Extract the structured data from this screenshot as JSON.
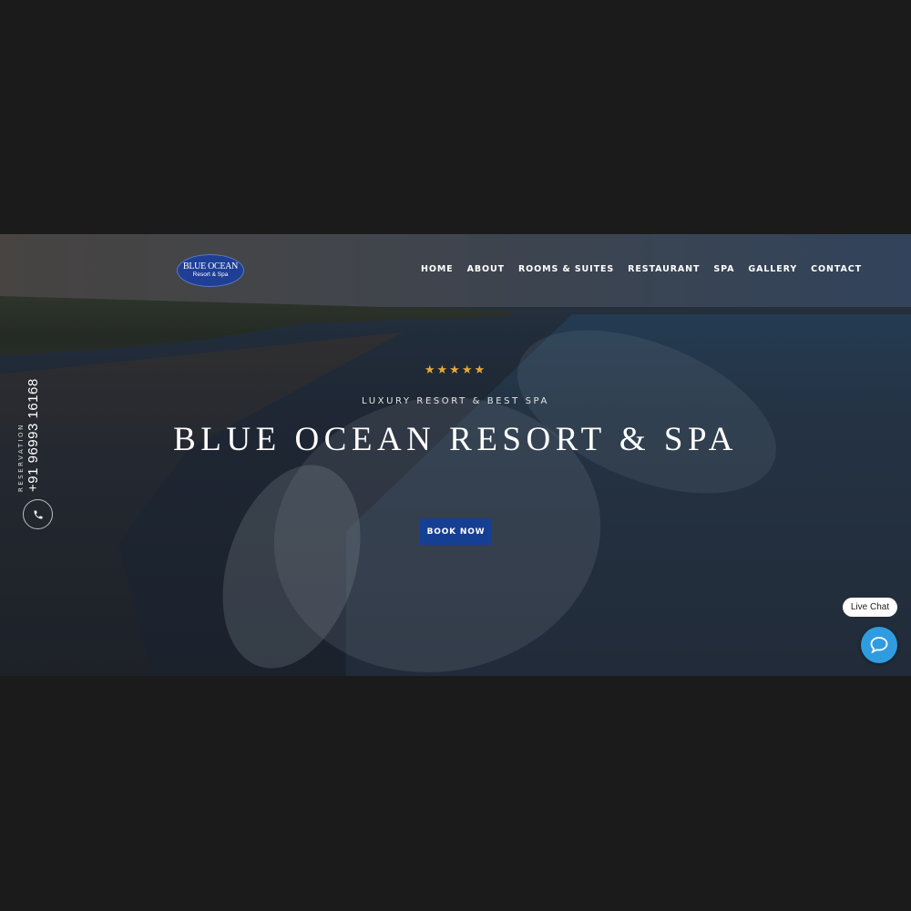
{
  "brand": {
    "logo_main": "BLUE OCEAN",
    "logo_sub": "Resort & Spa"
  },
  "nav": {
    "items": [
      {
        "label": "HOME"
      },
      {
        "label": "ABOUT"
      },
      {
        "label": "ROOMS & SUITES"
      },
      {
        "label": "RESTAURANT"
      },
      {
        "label": "SPA"
      },
      {
        "label": "GALLERY"
      },
      {
        "label": "CONTACT"
      }
    ]
  },
  "hero": {
    "stars": "★★★★★",
    "rating": 5,
    "tagline": "LUXURY RESORT & BEST SPA",
    "title": "BLUE OCEAN RESORT & SPA",
    "cta_label": "BOOK NOW"
  },
  "reservation": {
    "label": "RESERVATION",
    "phone": "+91 96993 16168"
  },
  "chat": {
    "label": "Live Chat"
  },
  "colors": {
    "page_background": "#1b1b1b",
    "accent_blue": "#153f93",
    "star_gold": "#e7a73c",
    "chat_blue": "#2f9ce0"
  },
  "icons": {
    "phone": "phone-icon",
    "chat": "chat-bubble-icon"
  }
}
